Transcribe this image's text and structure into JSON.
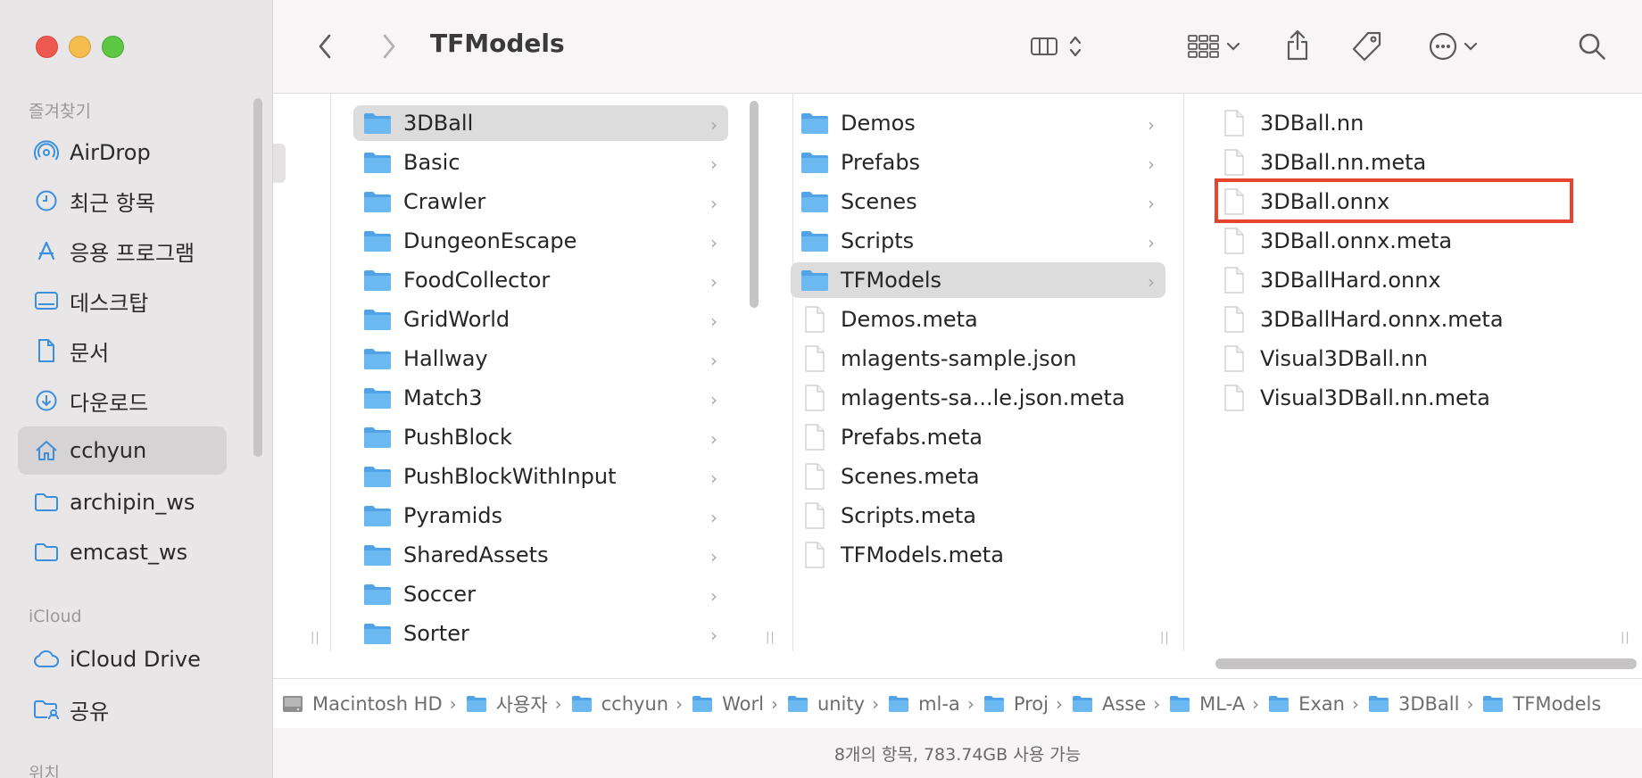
{
  "window": {
    "title": "TFModels"
  },
  "sidebar": {
    "favorites_heading": "즐겨찾기",
    "favorites": [
      {
        "label": "AirDrop",
        "icon": "airdrop-icon"
      },
      {
        "label": "최근 항목",
        "icon": "clock-icon"
      },
      {
        "label": "응용 프로그램",
        "icon": "applications-icon"
      },
      {
        "label": "데스크탑",
        "icon": "desktop-icon"
      },
      {
        "label": "문서",
        "icon": "document-icon"
      },
      {
        "label": "다운로드",
        "icon": "download-icon"
      },
      {
        "label": "cchyun",
        "icon": "home-icon",
        "selected": true
      },
      {
        "label": "archipin_ws",
        "icon": "folder-icon"
      },
      {
        "label": "emcast_ws",
        "icon": "folder-icon"
      }
    ],
    "icloud_heading": "iCloud",
    "icloud": [
      {
        "label": "iCloud Drive",
        "icon": "cloud-icon"
      },
      {
        "label": "공유",
        "icon": "shared-folder-icon"
      }
    ],
    "locations_heading": "위치"
  },
  "columns": {
    "col1": {
      "selected": "3DBall",
      "items": [
        "3DBall",
        "Basic",
        "Crawler",
        "DungeonEscape",
        "FoodCollector",
        "GridWorld",
        "Hallway",
        "Match3",
        "PushBlock",
        "PushBlockWithInput",
        "Pyramids",
        "SharedAssets",
        "Soccer",
        "Sorter"
      ]
    },
    "col2": {
      "selected": "TFModels",
      "folders": [
        "Demos",
        "Prefabs",
        "Scenes",
        "Scripts",
        "TFModels"
      ],
      "files": [
        "Demos.meta",
        "mlagents-sample.json",
        "mlagents-sa...le.json.meta",
        "Prefabs.meta",
        "Scenes.meta",
        "Scripts.meta",
        "TFModels.meta"
      ]
    },
    "col3": {
      "files": [
        "3DBall.nn",
        "3DBall.nn.meta",
        "3DBall.onnx",
        "3DBall.onnx.meta",
        "3DBallHard.onnx",
        "3DBallHard.onnx.meta",
        "Visual3DBall.nn",
        "Visual3DBall.nn.meta"
      ],
      "highlighted": "3DBall.onnx"
    }
  },
  "pathbar": {
    "crumbs": [
      "Macintosh HD",
      "사용자",
      "cchyun",
      "Worl",
      "unity",
      "ml-a",
      "Proj",
      "Asse",
      "ML-A",
      "Exan",
      "3DBall",
      "TFModels"
    ]
  },
  "status": {
    "text": "8개의 항목, 783.74GB 사용 가능"
  },
  "colors": {
    "folder": "#5aabe8",
    "highlight": "#e5442f",
    "selection": "#dcdcdc"
  }
}
